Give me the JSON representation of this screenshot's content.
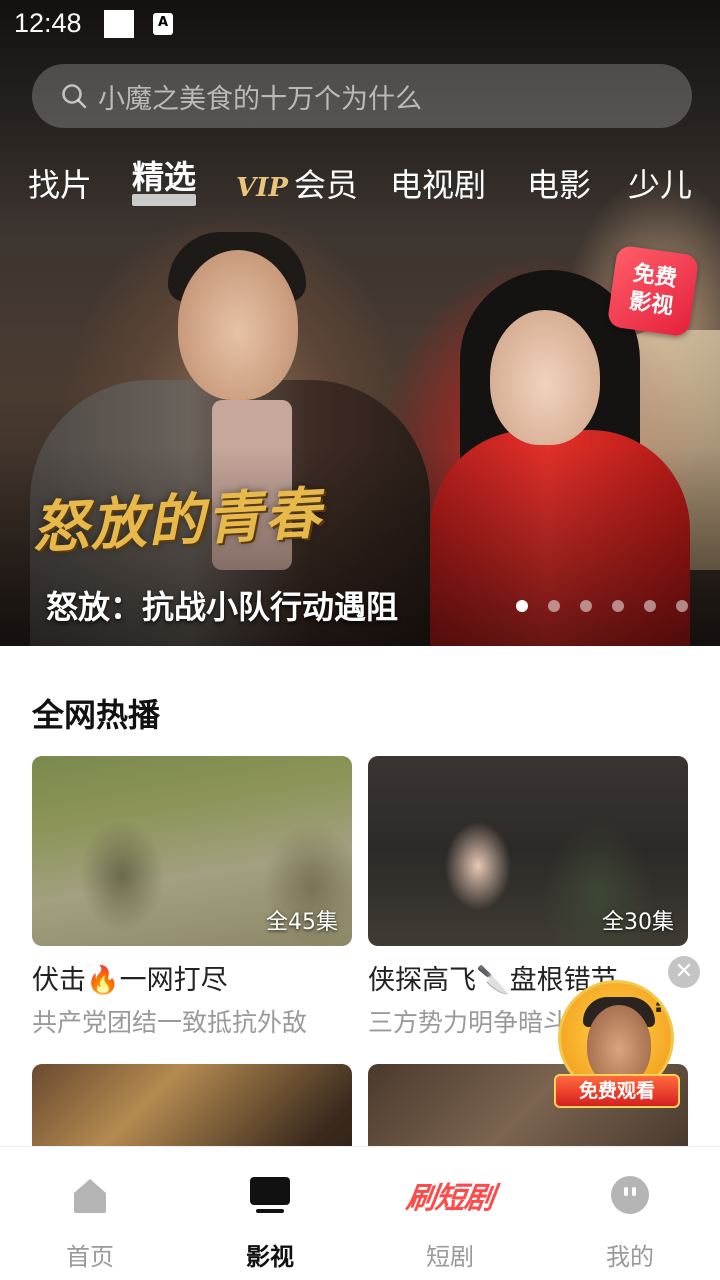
{
  "status_bar": {
    "time": "12:48",
    "a_icon_letter": "A"
  },
  "search": {
    "placeholder": "小魔之美食的十万个为什么"
  },
  "category_tabs": [
    {
      "label": "找片",
      "active": false
    },
    {
      "label": "精选",
      "active": true
    },
    {
      "label": "会员",
      "badge": "VIP",
      "active": false
    },
    {
      "label": "电视剧",
      "active": false
    },
    {
      "label": "电影",
      "active": false
    },
    {
      "label": "少儿",
      "active": false
    }
  ],
  "hero": {
    "show_logo": "怒放的青春",
    "caption": "怒放：抗战小队行动遇阻",
    "badge_line1": "免费",
    "badge_line2": "影视",
    "carousel_count": 6,
    "carousel_active_index": 0
  },
  "hot_section": {
    "title": "全网热播",
    "cards": [
      {
        "title": "伏击🔥一网打尽",
        "subtitle": "共产党团结一致抵抗外敌",
        "episodes": "全45集"
      },
      {
        "title": "侠探高飞🔪盘根错节",
        "subtitle": "三方势力明争暗斗",
        "episodes": "全30集"
      },
      {
        "title": "",
        "subtitle": "",
        "episodes": ""
      },
      {
        "title": "",
        "subtitle": "",
        "episodes": ""
      }
    ]
  },
  "floating_ad": {
    "label": "免费观看",
    "close_glyph": "✕"
  },
  "bottom_nav": [
    {
      "label": "首页",
      "icon": "home-icon",
      "active": false
    },
    {
      "label": "影视",
      "icon": "tv-icon",
      "active": true
    },
    {
      "label": "短剧",
      "icon": "short-drama-logo",
      "logo_text": "刷短剧",
      "active": false
    },
    {
      "label": "我的",
      "icon": "profile-icon",
      "active": false
    }
  ],
  "colors": {
    "accent_red": "#ff4a4a",
    "vip_gold": "#e9c47a",
    "text_primary": "#111111",
    "text_secondary": "#9a9a9a"
  }
}
